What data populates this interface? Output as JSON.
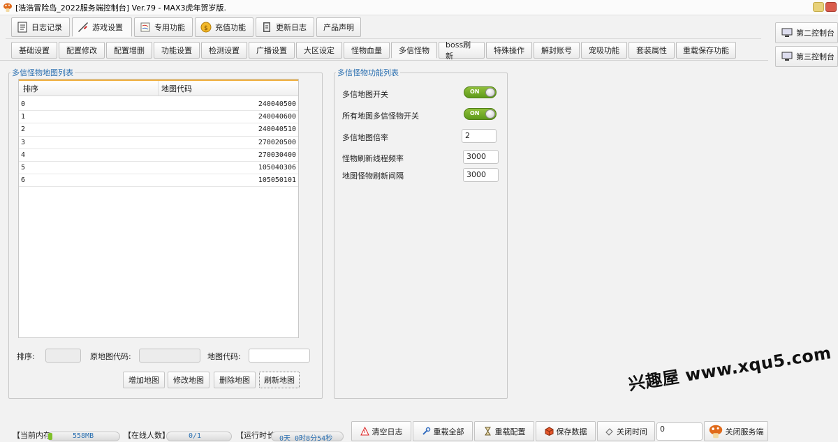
{
  "window": {
    "title": "[浩浩冒险岛_2022服务端控制台] Ver.79 - MAX3虎年贺岁版."
  },
  "main_tabs": [
    {
      "label": "日志记录",
      "icon": "notebook-icon"
    },
    {
      "label": "游戏设置",
      "icon": "sword-icon"
    },
    {
      "label": "专用功能",
      "icon": "scroll-icon"
    },
    {
      "label": "充值功能",
      "icon": "coin-icon"
    },
    {
      "label": "更新日志",
      "icon": "book-icon"
    },
    {
      "label": "产品声明",
      "icon": ""
    }
  ],
  "sub_tabs": [
    "基础设置",
    "配置修改",
    "配置增删",
    "功能设置",
    "检测设置",
    "广播设置",
    "大区设定",
    "怪物血量",
    "多信怪物",
    "boss刷新",
    "特殊操作",
    "解封账号",
    "宠吸功能",
    "套装属性",
    "重载保存功能"
  ],
  "side_buttons": [
    {
      "label": "第二控制台",
      "icon": "computer-icon"
    },
    {
      "label": "第三控制台",
      "icon": "computer-icon"
    }
  ],
  "map_list": {
    "title": "多信怪物地图列表",
    "columns": [
      "排序",
      "地图代码"
    ],
    "rows": [
      {
        "order": "0",
        "code": "240040500"
      },
      {
        "order": "1",
        "code": "240040600"
      },
      {
        "order": "2",
        "code": "240040510"
      },
      {
        "order": "3",
        "code": "270020500"
      },
      {
        "order": "4",
        "code": "270030400"
      },
      {
        "order": "5",
        "code": "105040306"
      },
      {
        "order": "6",
        "code": "105050101"
      }
    ],
    "form": {
      "order_label": "排序:",
      "order_value": "",
      "orig_code_label": "原地图代码:",
      "orig_code_value": "",
      "code_label": "地图代码:",
      "code_value": ""
    },
    "buttons": {
      "add": "增加地图",
      "edit": "修改地图",
      "delete": "删除地图",
      "refresh": "刷新地图"
    }
  },
  "features": {
    "title": "多信怪物功能列表",
    "map_switch_label": "多信地图开关",
    "map_switch_state": "ON",
    "all_switch_label": "所有地图多信怪物开关",
    "all_switch_state": "ON",
    "rate_label": "多信地图倍率",
    "rate_value": "2",
    "thread_freq_label": "怪物刷新线程频率",
    "thread_freq_value": "3000",
    "refresh_interval_label": "地图怪物刷新间隔",
    "refresh_interval_value": "3000"
  },
  "status": {
    "memory_label": "【当前内存",
    "memory_value": "558MB",
    "online_label": "【在线人数】",
    "online_value": "0/1",
    "uptime_label": "【运行时长",
    "uptime_value": "0天 0时8分54秒"
  },
  "bottom_buttons": {
    "clear_log": "清空日志",
    "reload_all": "重载全部",
    "reload_config": "重载配置",
    "save_data": "保存数据",
    "close_time": "关闭时间",
    "close_time_value": "0",
    "close_server": "关闭服务端"
  },
  "watermark": "兴趣屋 www.xqu5.com",
  "colors": {
    "accent_blue": "#2a6fb0",
    "toggle_green": "#6ea524",
    "header_orange": "#f0b040"
  }
}
